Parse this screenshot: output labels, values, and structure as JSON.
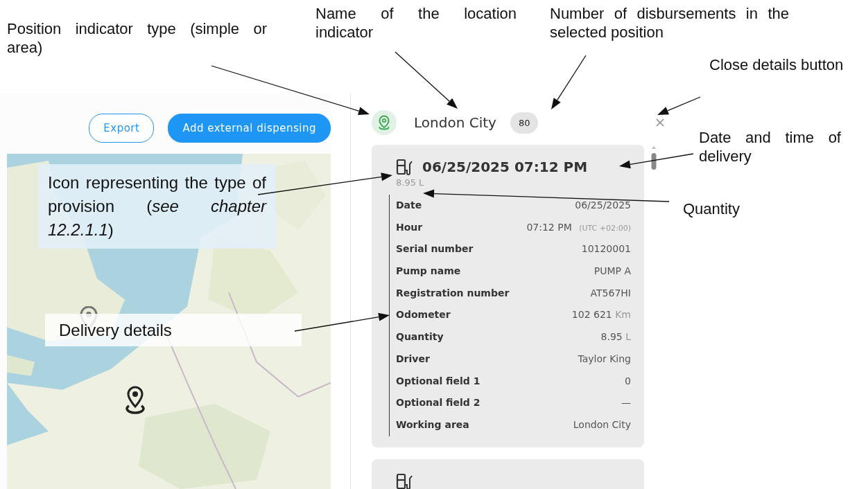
{
  "annotations": [
    {
      "text": "Position indicator type (simple or area)"
    },
    {
      "text": "Name of the location indicator"
    },
    {
      "text": "Number of disbursements in the selected position"
    },
    {
      "text": "Close details button"
    },
    {
      "text": "Date and time of delivery"
    },
    {
      "text": "Icon representing the type of provision (*see chapter 12.2.1.1*)"
    },
    {
      "text": "Quantity"
    },
    {
      "text": "Delivery details"
    }
  ],
  "toolbar": {
    "buttons": [
      {
        "label": "Export",
        "kind": "outline"
      },
      {
        "label": "Add external dispensing",
        "kind": "primary"
      }
    ]
  },
  "details": {
    "name": "London City",
    "count": "80",
    "deliveries": [
      {
        "kind": "expanded",
        "datetime": "06/25/2025 07:12 PM",
        "quantity": "8.95 L",
        "fields": [
          {
            "label": "Date",
            "value": "06/25/2025"
          },
          {
            "label": "Hour",
            "value": "07:12 PM",
            "unit": "(UTC +02:00)"
          },
          {
            "label": "Serial number",
            "value": "10120001"
          },
          {
            "label": "Pump name",
            "value": "PUMP A"
          },
          {
            "label": "Registration number",
            "value": "AT567HI"
          },
          {
            "label": "Odometer",
            "value": "102 621",
            "unit": "Km"
          },
          {
            "label": "Quantity",
            "value": "8.95",
            "unit": "L"
          },
          {
            "label": "Driver",
            "value": "Taylor King"
          },
          {
            "label": "Optional field 1",
            "value": "0"
          },
          {
            "label": "Optional field 2",
            "value": "—"
          },
          {
            "label": "Working area",
            "value": "London City"
          }
        ]
      },
      {
        "kind": "collapsed"
      }
    ]
  }
}
